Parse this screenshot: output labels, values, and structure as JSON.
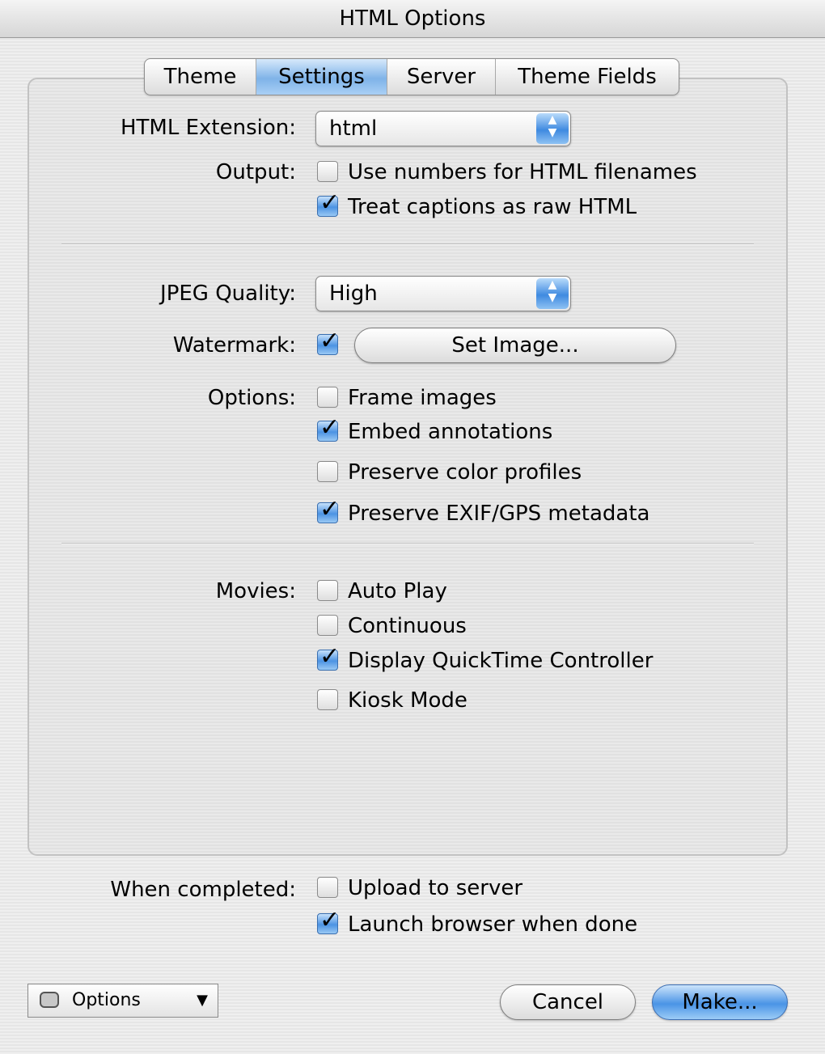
{
  "window": {
    "title": "HTML Options"
  },
  "tabs": [
    {
      "label": "Theme",
      "active": false
    },
    {
      "label": "Settings",
      "active": true
    },
    {
      "label": "Server",
      "active": false
    },
    {
      "label": "Theme Fields",
      "active": false
    }
  ],
  "html_extension": {
    "label": "HTML Extension:",
    "value": "html"
  },
  "output": {
    "label": "Output:",
    "options": [
      {
        "label": "Use numbers for HTML filenames",
        "checked": false
      },
      {
        "label": "Treat captions as raw HTML",
        "checked": true
      }
    ]
  },
  "jpeg_quality": {
    "label": "JPEG Quality:",
    "value": "High"
  },
  "watermark": {
    "label": "Watermark:",
    "checked": true,
    "button": "Set Image..."
  },
  "options": {
    "label": "Options:",
    "items": [
      {
        "label": "Frame images",
        "checked": false
      },
      {
        "label": "Embed annotations",
        "checked": true
      },
      {
        "label": "Preserve color profiles",
        "checked": false
      },
      {
        "label": "Preserve EXIF/GPS metadata",
        "checked": true
      }
    ]
  },
  "movies": {
    "label": "Movies:",
    "items": [
      {
        "label": "Auto Play",
        "checked": false
      },
      {
        "label": "Continuous",
        "checked": false
      },
      {
        "label": "Display QuickTime Controller",
        "checked": true
      },
      {
        "label": "Kiosk Mode",
        "checked": false
      }
    ]
  },
  "when_completed": {
    "label": "When completed:",
    "items": [
      {
        "label": "Upload to server",
        "checked": false
      },
      {
        "label": "Launch browser when done",
        "checked": true
      }
    ]
  },
  "footer": {
    "options_menu": "Options",
    "cancel": "Cancel",
    "make": "Make..."
  },
  "colors": {
    "accent": "#4a94e6",
    "background": "#ececec"
  }
}
